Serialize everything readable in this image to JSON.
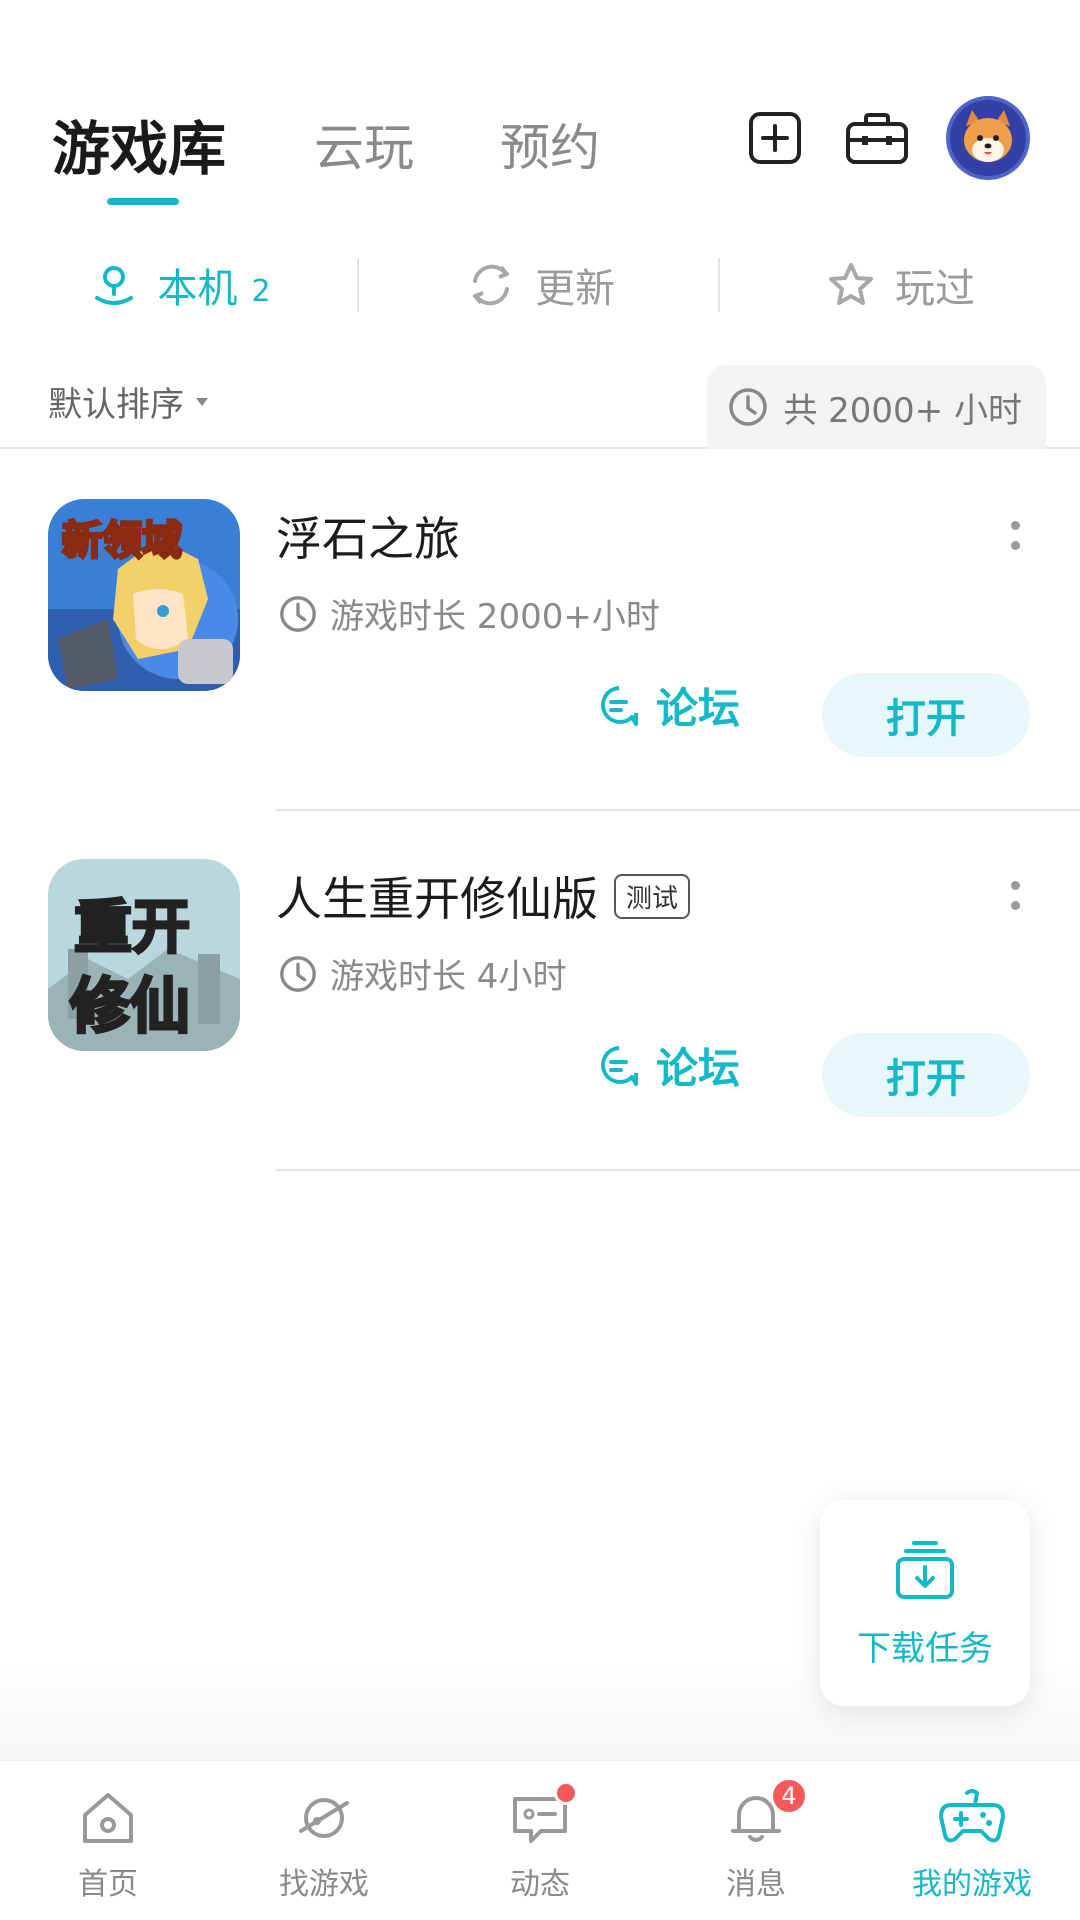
{
  "top_tabs": {
    "library": "游戏库",
    "cloud": "云玩",
    "reserve": "预约"
  },
  "filters": {
    "local": {
      "label": "本机",
      "count": "2"
    },
    "update": {
      "label": "更新"
    },
    "played": {
      "label": "玩过"
    }
  },
  "sort": {
    "label": "默认排序",
    "total": "共 2000+ 小时"
  },
  "games": [
    {
      "title": "浮石之旅",
      "icon_text": "新领域",
      "playtime": "游戏时长 2000+小时",
      "forum_label": "论坛",
      "open_label": "打开"
    },
    {
      "title": "人生重开修仙版",
      "tag": "测试",
      "icon_text_top": "重开",
      "icon_text_bottom": "修仙",
      "playtime": "游戏时长 4小时",
      "forum_label": "论坛",
      "open_label": "打开"
    }
  ],
  "download": {
    "label": "下载任务"
  },
  "bottom_nav": {
    "home": "首页",
    "discover": "找游戏",
    "feed": "动态",
    "messages": "消息",
    "messages_badge": "4",
    "my_games": "我的游戏"
  },
  "colors": {
    "accent": "#14b8c8",
    "badge": "#f45a5a"
  }
}
